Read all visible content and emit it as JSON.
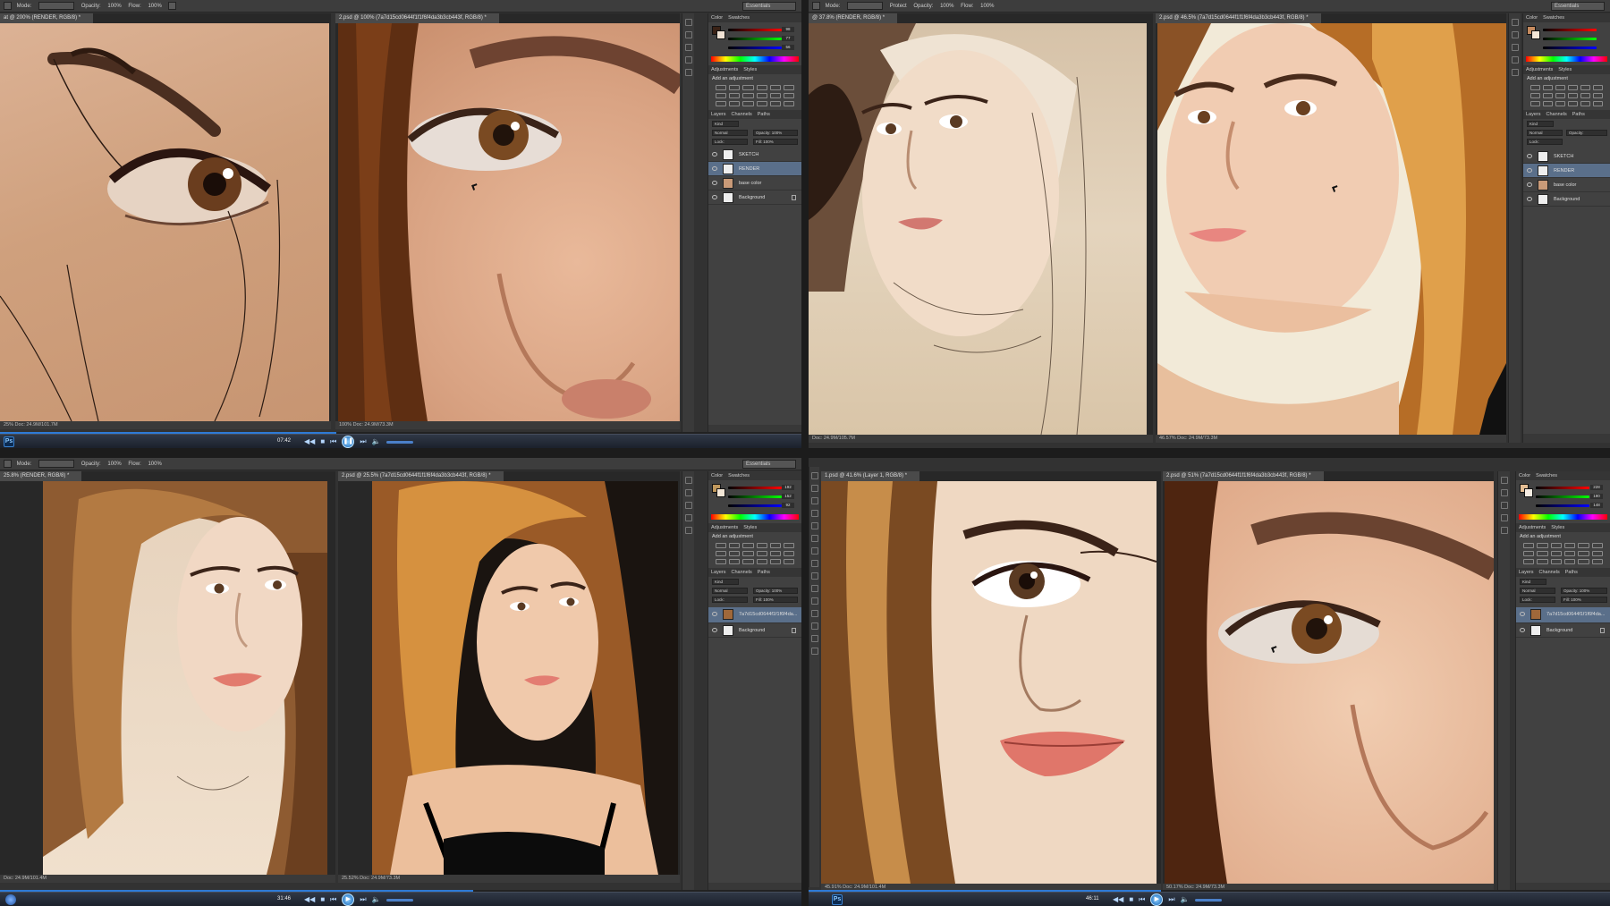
{
  "optbar": {
    "mode_label": "Mode:",
    "mode_value": "Normal",
    "opacity_label": "Opacity:",
    "opacity_value": "100%",
    "flow_label": "Flow:",
    "flow_value": "100%",
    "workspace": "Essentials",
    "q2_tool": "Protect",
    "q2_opacity_value": "100%",
    "q2_flow_value": "100%"
  },
  "panels": {
    "color_tabs": [
      "Color",
      "Swatches"
    ],
    "adj_tabs": [
      "Adjustments",
      "Styles"
    ],
    "adj_title": "Add an adjustment",
    "layer_tabs": [
      "Layers",
      "Channels",
      "Paths"
    ],
    "kind": "Kind",
    "blend": "Normal",
    "opacity_label": "Opacity:",
    "opacity_value": "100%",
    "lock_label": "Lock:",
    "fill_label": "Fill:",
    "fill_value": "100%",
    "q1_rgb": [
      "98",
      "77",
      "56"
    ],
    "q3_rgb": [
      "192",
      "152",
      "92"
    ],
    "q4_rgb": [
      "228",
      "190",
      "148"
    ]
  },
  "quads": {
    "q1": {
      "left_tab": "at @ 200% (RENDER, RGB/8) *",
      "right_tab": "2.psd @ 100% (7a7d15cd0644f1f1f6f4da3b3cb443f, RGB/8) *",
      "left_status": "25%  Doc: 24.9M/101.7M",
      "right_status": "100%  Doc: 24.9M/73.3M",
      "layers": [
        "SKETCH",
        "RENDER",
        "base color",
        "Background"
      ],
      "time": "07:42",
      "progress": 0.42
    },
    "q2": {
      "left_tab": "@ 37.8% (RENDER, RGB/8) *",
      "right_tab": "2.psd @ 46.5% (7a7d15cd0644f1f1f6f4da3b3cb443f, RGB/8) *",
      "left_status": "Doc: 24.9M/105.7M",
      "right_status": "46.57%  Doc: 24.9M/73.3M",
      "layers": [
        "SKETCH",
        "RENDER",
        "base color",
        "Background"
      ]
    },
    "q3": {
      "left_tab": "25.8% (RENDER, RGB/8) *",
      "right_tab": "2.psd @ 25.5% (7a7d15cd0644f1f1f6f4da3b3cb443f, RGB/8) *",
      "left_status": "Doc: 24.9M/101.4M",
      "right_status": "25.52%  Doc: 24.9M/73.3M",
      "layers": [
        "7a7d15cd0644f1f1f6f4da...",
        "Background"
      ],
      "time": "31:46",
      "progress": 0.59
    },
    "q4": {
      "left_tab": "1.psd @ 41.6% (Layer 1, RGB/8) *",
      "right_tab": "2.psd @ 51% (7a7d15cd0644f1f1f6f4da3b3cb443f, RGB/8) *",
      "left_status": "45.91%  Doc: 24.9M/101.4M",
      "right_status": "50.17%  Doc: 24.9M/73.3M",
      "layers": [
        "7a7d15cd0644f1f1f6f4da...",
        "Background"
      ],
      "time": "46:11",
      "progress": 0.44
    }
  }
}
